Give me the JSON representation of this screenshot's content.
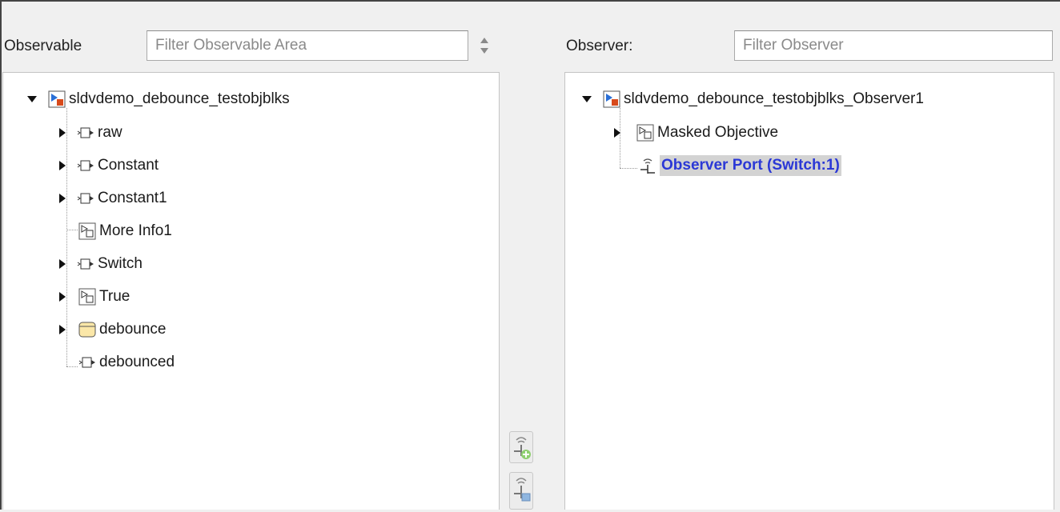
{
  "observable": {
    "label": "Observable",
    "filter_placeholder": "Filter Observable Area",
    "tree": {
      "root": "sldvdemo_debounce_testobjblks",
      "items": [
        {
          "label": "raw",
          "icon": "port-block-icon"
        },
        {
          "label": "Constant",
          "icon": "port-block-icon"
        },
        {
          "label": "Constant1",
          "icon": "port-block-icon"
        },
        {
          "label": "More Info1",
          "icon": "masked-subsystem-icon"
        },
        {
          "label": "Switch",
          "icon": "port-block-icon"
        },
        {
          "label": "True",
          "icon": "masked-subsystem-icon"
        },
        {
          "label": "debounce",
          "icon": "chart-icon"
        },
        {
          "label": "debounced",
          "icon": "port-block-icon"
        }
      ]
    }
  },
  "observer": {
    "label": "Observer:",
    "filter_placeholder": "Filter Observer",
    "tree": {
      "root": "sldvdemo_debounce_testobjblks_Observer1",
      "items": [
        {
          "label": "Masked Objective",
          "icon": "masked-subsystem-icon"
        },
        {
          "label": "Observer Port (Switch:1)",
          "icon": "observer-port-icon",
          "selected": true
        }
      ]
    }
  },
  "buttons": {
    "add_observer_port": "add-observer-port-icon",
    "map_observer_port": "map-observer-port-icon"
  },
  "colors": {
    "selection_text": "#2b38d6",
    "selection_bg": "#d3d3d3"
  }
}
